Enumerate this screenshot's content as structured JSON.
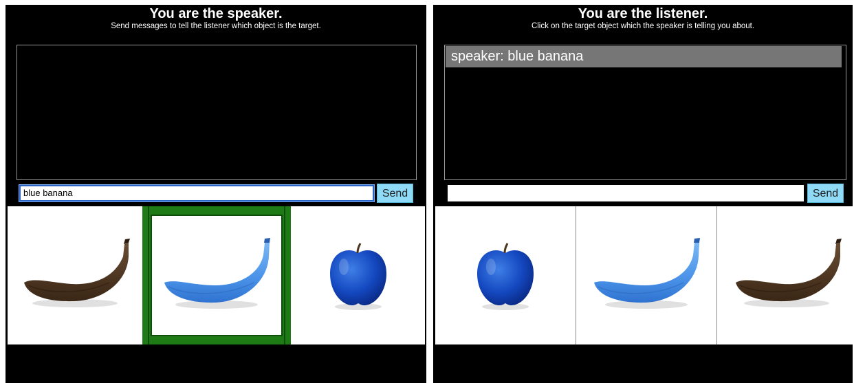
{
  "speaker": {
    "title": "You are the speaker.",
    "subtitle": "Send messages to tell the listener which object is the target.",
    "input_value": "blue banana",
    "send_label": "Send",
    "objects": [
      {
        "kind": "banana",
        "color": "brown",
        "is_target": false
      },
      {
        "kind": "banana",
        "color": "blue",
        "is_target": true
      },
      {
        "kind": "apple",
        "color": "blue",
        "is_target": false
      }
    ]
  },
  "listener": {
    "title": "You are the listener.",
    "subtitle": "Click on the target object which the speaker is telling you about.",
    "messages": [
      "speaker: blue banana"
    ],
    "input_value": "",
    "send_label": "Send",
    "objects": [
      {
        "kind": "apple",
        "color": "blue"
      },
      {
        "kind": "banana",
        "color": "blue"
      },
      {
        "kind": "banana",
        "color": "brown"
      }
    ]
  },
  "colors": {
    "target_highlight": "#1d7a15",
    "send_button": "#8fdaf7",
    "message_bg": "#767676",
    "panel_bg": "#000000"
  }
}
